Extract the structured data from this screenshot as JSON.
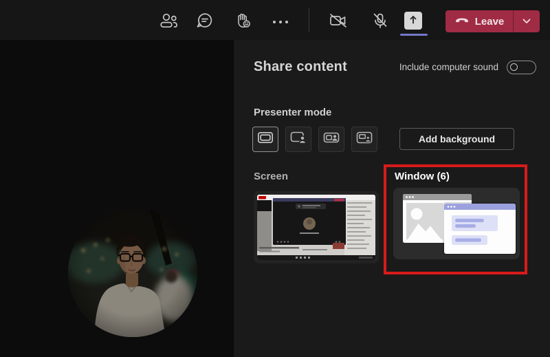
{
  "topbar": {
    "leave_button": {
      "label": "Leave"
    },
    "icons": {
      "participants": "participants-icon",
      "chat": "chat-icon",
      "reactions": "reactions-icon",
      "more": "more-icon",
      "camera": "camera-off-icon",
      "mic": "mic-off-icon",
      "share": "share-screen-icon",
      "hangup": "hangup-icon",
      "chevron": "chevron-down-icon"
    }
  },
  "share_panel": {
    "title": "Share content",
    "computer_sound": {
      "label": "Include computer sound",
      "enabled": false
    },
    "presenter_mode": {
      "label": "Presenter mode",
      "mode_icons": [
        "content-only-icon",
        "standout-icon",
        "side-by-side-icon",
        "reporter-icon"
      ],
      "selected_mode_index": 0,
      "add_background_label": "Add background"
    },
    "sources": {
      "screen": {
        "label": "Screen"
      },
      "window": {
        "label": "Window (6)",
        "highlighted": true
      }
    }
  },
  "colors": {
    "leave_button_red": "#a02b44",
    "highlight_border_red": "#d81a1a",
    "share_active_underline": "#7478c8",
    "window_titlebar_lavender": "#9ba1de",
    "panel_background": "#1b1a1a"
  }
}
